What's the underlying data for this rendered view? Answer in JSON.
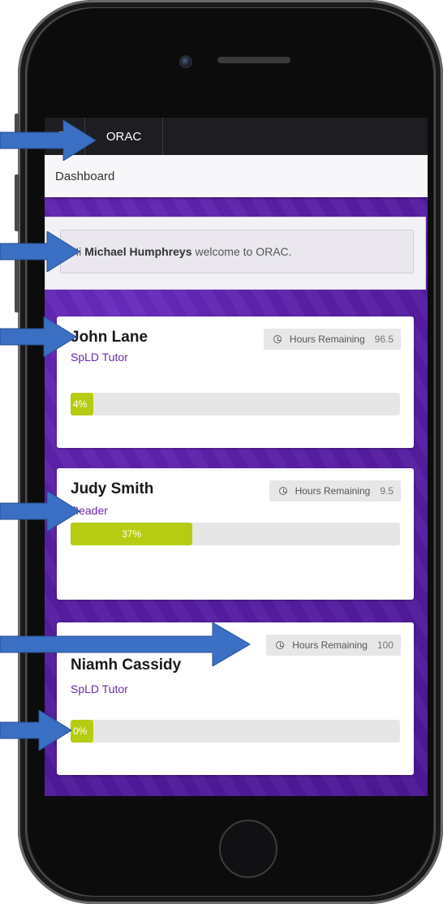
{
  "app": {
    "brand": "ORAC",
    "breadcrumb": "Dashboard"
  },
  "welcome": {
    "greeting": "Hi",
    "user_name": "Michael Humphreys",
    "suffix": "welcome to ORAC."
  },
  "hours_label": "Hours Remaining",
  "tutors": [
    {
      "name": "John Lane",
      "role": "SpLD Tutor",
      "hours": "96.5",
      "progress_label": "4%",
      "progress": 4
    },
    {
      "name": "Judy Smith",
      "role": "Reader",
      "hours": "9.5",
      "progress_label": "37%",
      "progress": 37
    },
    {
      "name": "Niamh Cassidy",
      "role": "SpLD Tutor",
      "hours": "100",
      "progress_label": "0%",
      "progress": 0
    }
  ],
  "colors": {
    "accent_purple": "#5b1fa8",
    "progress_green": "#b6cc12",
    "arrow_blue": "#3a6fc4",
    "navbar": "#1e1e22"
  },
  "icons": [
    "menu-icon",
    "clock-icon",
    "camera-icon"
  ]
}
